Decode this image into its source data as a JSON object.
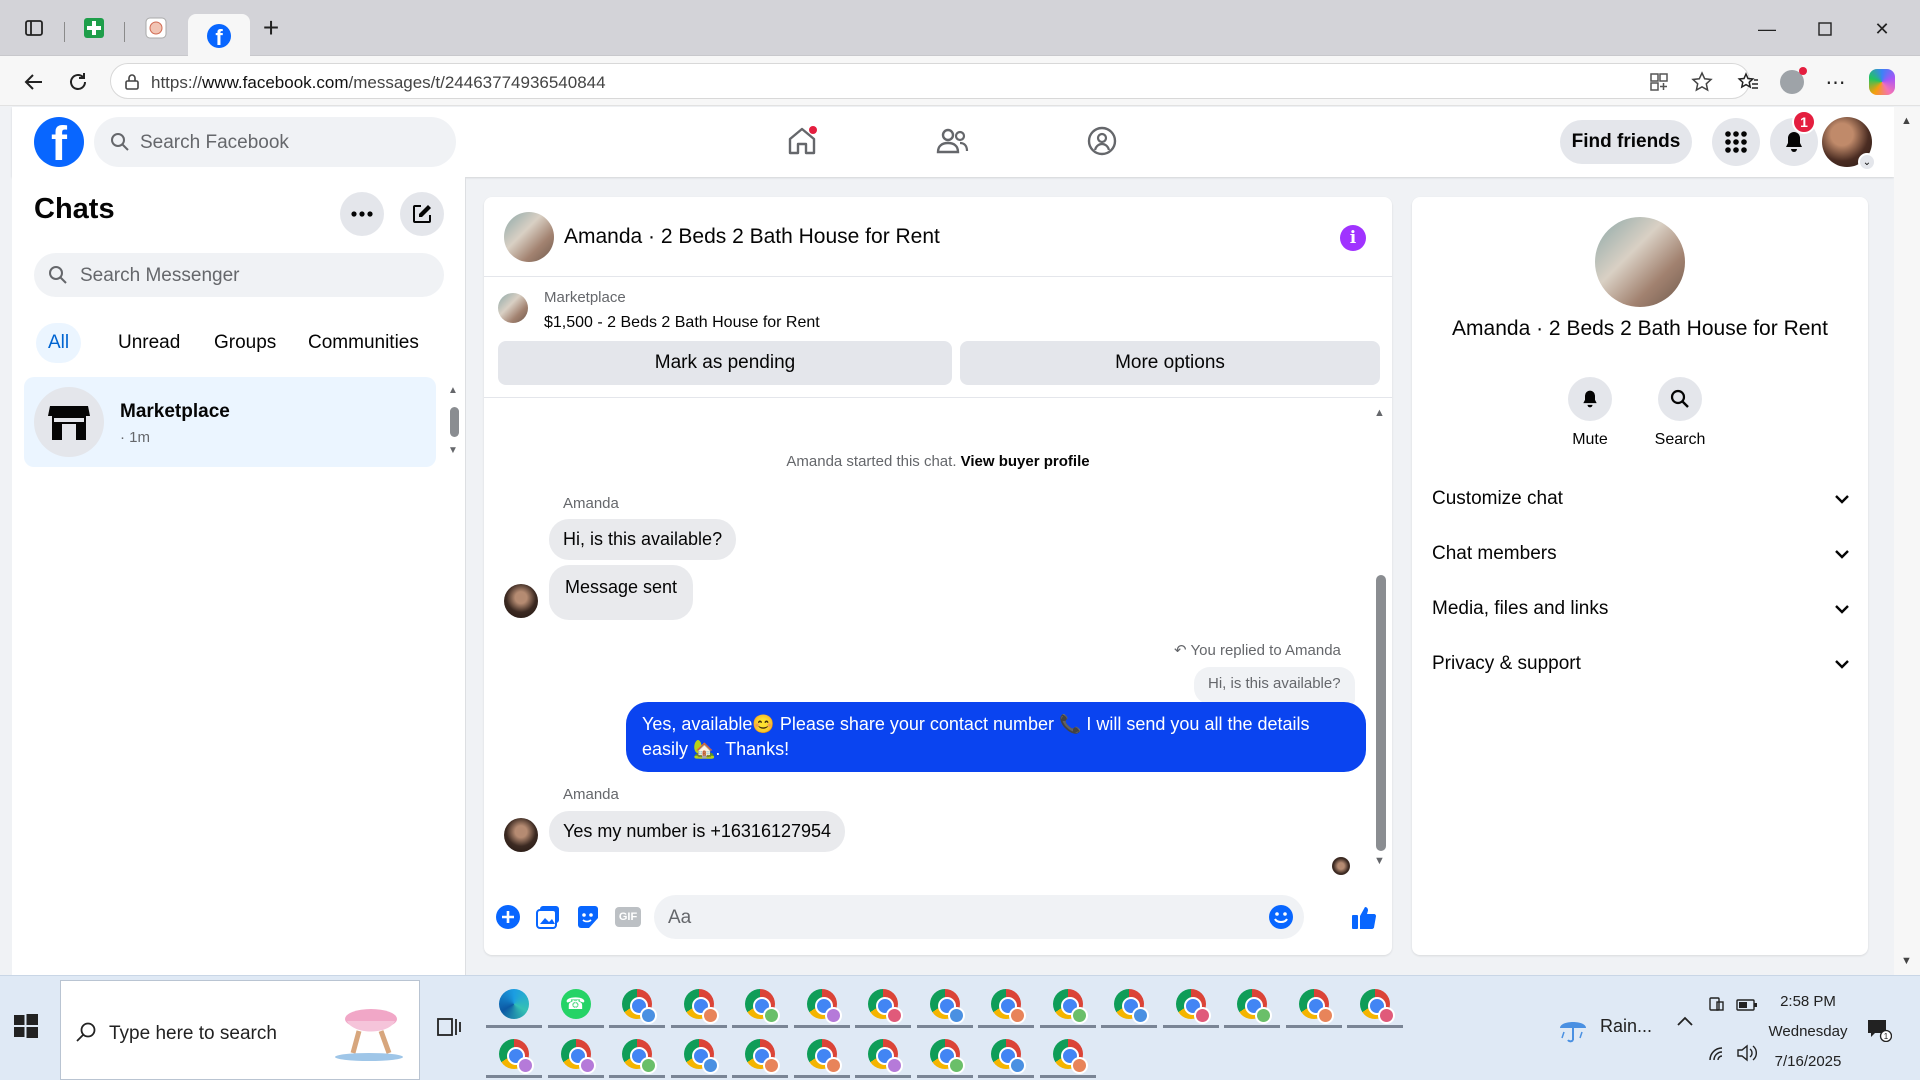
{
  "browser": {
    "url_prefix": "https://",
    "url_domain": "www.facebook.com",
    "url_path": "/messages/t/24463774936540844",
    "new_tab_label": "+"
  },
  "facebook": {
    "search_placeholder": "Search Facebook",
    "find_friends_label": "Find friends",
    "notification_count": "1"
  },
  "chats": {
    "title": "Chats",
    "search_placeholder": "Search Messenger",
    "filters": [
      "All",
      "Unread",
      "Groups",
      "Communities"
    ],
    "items": [
      {
        "name": "Marketplace",
        "time": "· 1m"
      }
    ]
  },
  "conversation": {
    "title": "Amanda · 2 Beds 2 Bath House for Rent",
    "listing_label": "Marketplace",
    "listing_price": "$1,500 - 2 Beds 2 Bath House for Rent",
    "mark_pending_label": "Mark as pending",
    "more_options_label": "More options",
    "started_text": "Amanda started this chat.",
    "view_buyer_label": "View buyer profile",
    "messages": [
      {
        "sender": "Amanda",
        "text": "Hi, is this available?"
      },
      {
        "sender": "Amanda",
        "text": "Message sent"
      },
      {
        "sender": "me",
        "replied_label": "You replied to Amanda",
        "quoted": "Hi, is this available?",
        "text": "Yes, available😊 Please share your contact number 📞 I will send you all the details easily 🏡. Thanks!"
      },
      {
        "sender": "Amanda",
        "text": "Yes my number is +16316127954"
      }
    ],
    "composer_placeholder": "Aa"
  },
  "info_panel": {
    "name": "Amanda · 2 Beds 2 Bath House for Rent",
    "actions": [
      "Mute",
      "Search"
    ],
    "sections": [
      "Customize chat",
      "Chat members",
      "Media, files and links",
      "Privacy & support"
    ]
  },
  "taskbar": {
    "search_placeholder": "Type here to search",
    "weather": "Rain...",
    "time": "2:58 PM",
    "day": "Wednesday",
    "date": "7/16/2025",
    "chrome_profile_colors": [
      "#4a90e2",
      "#e8845a",
      "#6abf69",
      "#b57ad9",
      "#e05a7a",
      "#4a90e2",
      "#e8845a",
      "#6abf69",
      "#4a90e2",
      "#e05a7a",
      "#6abf69",
      "#e8845a",
      "#e05a7a",
      "#b57ad9",
      "#b57ad9",
      "#6abf69",
      "#4a90e2",
      "#e8845a",
      "#e8845a",
      "#b57ad9",
      "#6abf69",
      "#4a90e2",
      "#e8845a",
      "#4a90e2",
      "#4a90e2"
    ]
  },
  "colors": {
    "fb_blue": "#0866ff",
    "outgoing_bubble": "#0a44f0",
    "info_purple": "#a033ff",
    "badge_red": "#e41e3f"
  }
}
